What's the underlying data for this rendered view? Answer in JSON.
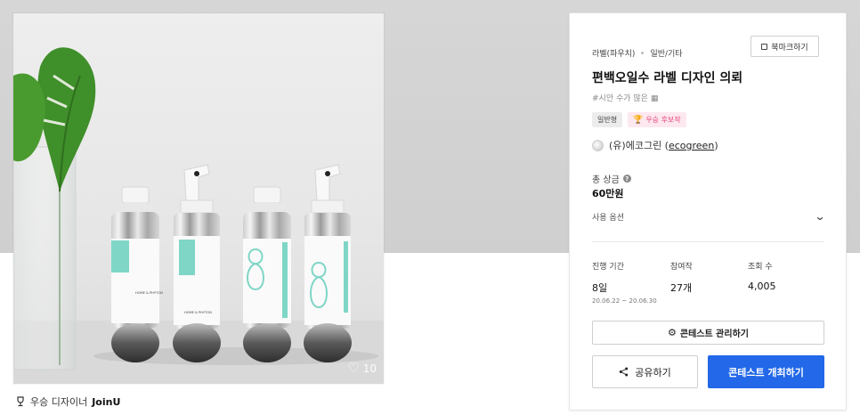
{
  "hero": {
    "alt_subject": "product-bottles-image",
    "like_count": "10",
    "bottle_label": "HOME & PHYTON"
  },
  "designer": {
    "prefix": "우승 디자이너",
    "name": "JoinU"
  },
  "card": {
    "category": "라벨(파우치)",
    "subcategory": "일반/기타",
    "bookmark_label": "북마크하기",
    "title": "편백오일수 라벨 디자인 의뢰",
    "hashtag": "#시안 수가 많은",
    "badges": [
      "일반형",
      "우승 후보작"
    ],
    "company_prefix": "(유)에코그린 (",
    "company_link": "ecogreen",
    "company_suffix": ")",
    "prize_label": "총 상금",
    "prize_value": "60만원",
    "options_label": "사용 옵션",
    "stats": [
      {
        "label": "진행 기간",
        "value": "8일",
        "sub": "20.06.22 ~ 20.06.30"
      },
      {
        "label": "참여작",
        "value": "27개",
        "sub": ""
      },
      {
        "label": "조회 수",
        "value": "4,005",
        "sub": ""
      }
    ],
    "manage_label": "콘테스트 관리하기",
    "share_label": "공유하기",
    "host_label": "콘테스트 개최하기"
  },
  "colors": {
    "primary": "#2268e8",
    "badge_pink_bg": "#fde8f0",
    "badge_pink_text": "#e8467a",
    "mint": "#7fd6c6"
  }
}
